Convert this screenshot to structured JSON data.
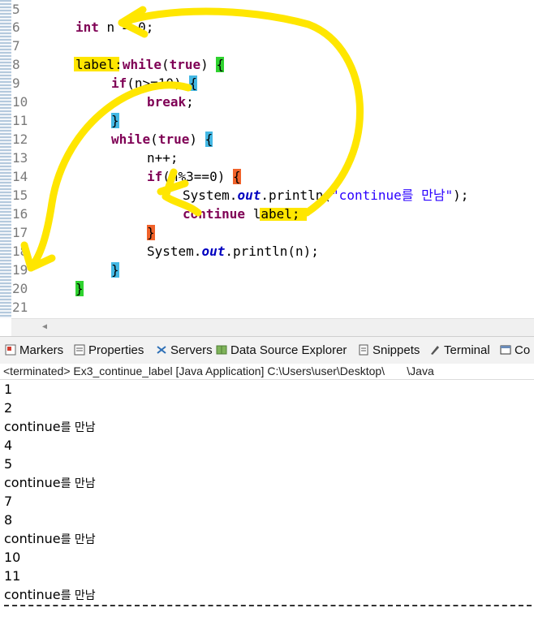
{
  "editor": {
    "line_numbers": [
      "5",
      "6",
      "7",
      "8",
      "9",
      "10",
      "11",
      "12",
      "13",
      "14",
      "15",
      "16",
      "17",
      "18",
      "19",
      "20",
      "21"
    ],
    "code": {
      "l6_kw": "int",
      "l6_rest": " n = 0;",
      "l8_label": "label",
      "l8_colon": ":",
      "l8_while": "while",
      "l8_paren_open": "(",
      "l8_true": "true",
      "l8_paren_close": ") ",
      "l8_brace": "{",
      "l9_if": "if",
      "l9_cond": "(n>=10) ",
      "l9_brace": "{",
      "l10_break": "break",
      "l10_semi": ";",
      "l11_brace": "}",
      "l12_while": "while",
      "l12_paren_open": "(",
      "l12_true": "true",
      "l12_paren_close": ") ",
      "l12_brace": "{",
      "l13_text": "n++;",
      "l14_if": "if",
      "l14_cond": "(n%3==0) ",
      "l14_brace": "{",
      "l15_sys": "System.",
      "l15_out": "out",
      "l15_println": ".println(",
      "l15_str": "\"continue를 만남\"",
      "l15_end": ");",
      "l16_continue": "continue",
      "l16_space": " ",
      "l16_label": "label",
      "l16_semi": ";",
      "l17_brace": "}",
      "l18_sys": "System.",
      "l18_out": "out",
      "l18_rest": ".println(n);",
      "l19_brace": "}",
      "l20_brace": "}"
    }
  },
  "views": {
    "tabs": [
      {
        "label": "Markers",
        "icon": "markers-icon"
      },
      {
        "label": "Properties",
        "icon": "properties-icon"
      },
      {
        "label": "Servers",
        "icon": "servers-icon"
      },
      {
        "label": "Data Source Explorer",
        "icon": "data-source-icon"
      },
      {
        "label": "Snippets",
        "icon": "snippets-icon"
      },
      {
        "label": "Terminal",
        "icon": "terminal-icon"
      },
      {
        "label": "Co",
        "icon": "console-icon"
      }
    ]
  },
  "console": {
    "title": "<terminated> Ex3_continue_label [Java Application] C:\\Users\\user\\Desktop\\       \\Java",
    "lines": [
      {
        "num": "1"
      },
      {
        "num": "2"
      },
      {
        "num": "continue",
        "kr": "를 만남"
      },
      {
        "num": "4"
      },
      {
        "num": "5"
      },
      {
        "num": "continue",
        "kr": "를 만남"
      },
      {
        "num": "7"
      },
      {
        "num": "8"
      },
      {
        "num": "continue",
        "kr": "를 만남"
      },
      {
        "num": "10"
      },
      {
        "num": "11"
      },
      {
        "num": "continue",
        "kr": "를 만남"
      }
    ]
  },
  "colors": {
    "keyword": "#7f0055",
    "string": "#2a00ff",
    "field": "#0000c0",
    "highlight": "#ffe600",
    "bracket_green": "#2fd22f",
    "bracket_blue": "#44b8e4",
    "bracket_orange": "#f0622a"
  }
}
